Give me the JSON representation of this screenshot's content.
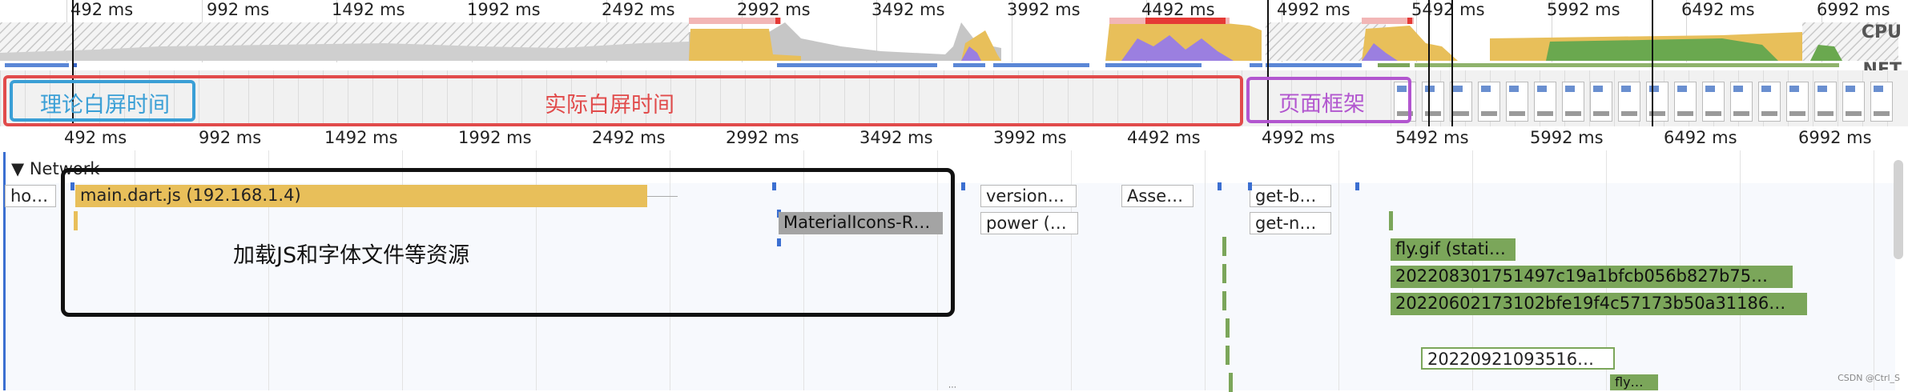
{
  "overview": {
    "ticks": [
      "492 ms",
      "992 ms",
      "1492 ms",
      "1992 ms",
      "2492 ms",
      "2992 ms",
      "3492 ms",
      "3992 ms",
      "4492 ms",
      "4992 ms",
      "5492 ms",
      "5992 ms",
      "6492 ms",
      "6992 ms"
    ],
    "cpu_label": "CPU",
    "net_label": "NET"
  },
  "annotations": {
    "theory_white_screen": "理论白屏时间",
    "actual_white_screen": "实际白屏时间",
    "page_frame": "页面框架",
    "load_resources": "加载JS和字体文件等资源",
    "colors": {
      "blue": "#3a9fd6",
      "red": "#e14b4b",
      "purple": "#b256cf",
      "black": "#111111"
    }
  },
  "main_ruler": {
    "ticks": [
      "492 ms",
      "992 ms",
      "1492 ms",
      "1992 ms",
      "2492 ms",
      "2992 ms",
      "3492 ms",
      "3992 ms",
      "4492 ms",
      "4992 ms",
      "5492 ms",
      "5992 ms",
      "6492 ms",
      "6992 ms"
    ]
  },
  "network": {
    "section_label": "Network",
    "requests": [
      "ho…",
      "main.dart.js (192.168.1.4)",
      "MaterialIcons-R…",
      "version…",
      "power (…",
      "Asse…",
      "get-b…",
      "get-n…",
      "fly.gif (stati…",
      "202208301751497c19a1bfcb056b827b75…",
      "20220602173102bfe19f4c57173b50a31186…",
      "20220921093516…",
      "fly…"
    ]
  },
  "watermark": "CSDN @Ctrl_S",
  "colors": {
    "cpu_gold": "#e8bf5a",
    "cpu_purple": "#9b7fe0",
    "cpu_green": "#6aa84f",
    "net_blue": "#5b87d6"
  }
}
